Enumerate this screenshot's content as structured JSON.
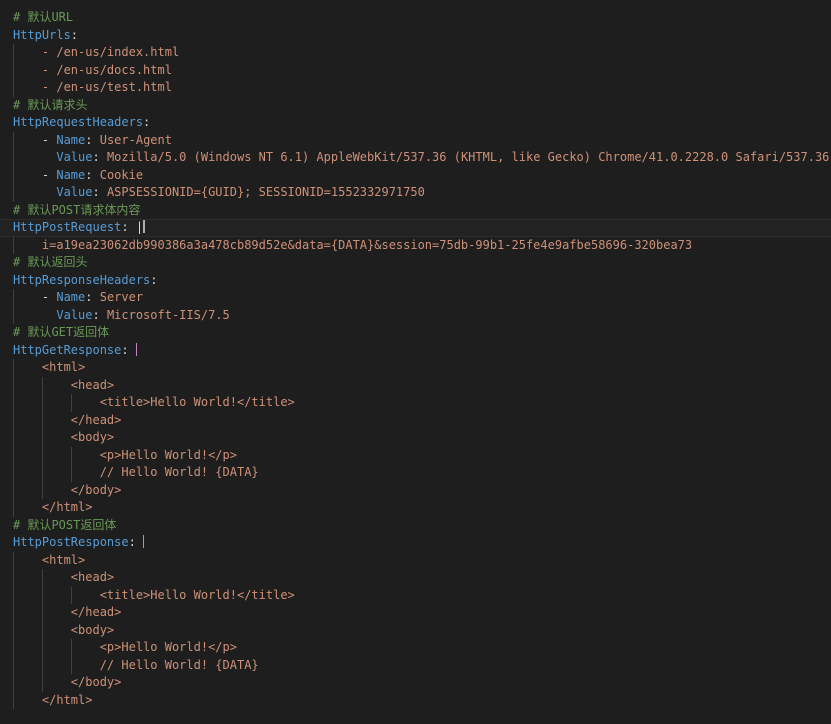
{
  "editor": {
    "lines": [
      {
        "indent": 0,
        "tokens": [
          {
            "t": "# 默认URL",
            "c": "comment"
          }
        ]
      },
      {
        "indent": 0,
        "tokens": [
          {
            "t": "HttpUrls",
            "c": "key"
          },
          {
            "t": ":",
            "c": "punct"
          }
        ]
      },
      {
        "indent": 1,
        "tokens": [
          {
            "t": "- /en-us/index.html",
            "c": "str"
          }
        ]
      },
      {
        "indent": 1,
        "tokens": [
          {
            "t": "- /en-us/docs.html",
            "c": "str"
          }
        ]
      },
      {
        "indent": 1,
        "tokens": [
          {
            "t": "- /en-us/test.html",
            "c": "str"
          }
        ]
      },
      {
        "indent": 0,
        "tokens": [
          {
            "t": "# 默认请求头",
            "c": "comment"
          }
        ]
      },
      {
        "indent": 0,
        "tokens": [
          {
            "t": "HttpRequestHeaders",
            "c": "key"
          },
          {
            "t": ":",
            "c": "punct"
          }
        ]
      },
      {
        "indent": 1,
        "tokens": [
          {
            "t": "- ",
            "c": "punct"
          },
          {
            "t": "Name",
            "c": "key"
          },
          {
            "t": ": ",
            "c": "punct"
          },
          {
            "t": "User-Agent",
            "c": "str"
          }
        ]
      },
      {
        "indent": 1,
        "extra": 2,
        "tokens": [
          {
            "t": "Value",
            "c": "key"
          },
          {
            "t": ": ",
            "c": "punct"
          },
          {
            "t": "Mozilla/5.0 (Windows NT 6.1) AppleWebKit/537.36 (KHTML, like Gecko) Chrome/41.0.2228.0 Safari/537.36",
            "c": "str"
          }
        ]
      },
      {
        "indent": 1,
        "tokens": [
          {
            "t": "- ",
            "c": "punct"
          },
          {
            "t": "Name",
            "c": "key"
          },
          {
            "t": ": ",
            "c": "punct"
          },
          {
            "t": "Cookie",
            "c": "str"
          }
        ]
      },
      {
        "indent": 1,
        "extra": 2,
        "tokens": [
          {
            "t": "Value",
            "c": "key"
          },
          {
            "t": ": ",
            "c": "punct"
          },
          {
            "t": "ASPSESSIONID={GUID}; SESSIONID=1552332971750",
            "c": "str"
          }
        ]
      },
      {
        "indent": 0,
        "tokens": [
          {
            "t": "# 默认POST请求体内容",
            "c": "comment"
          }
        ]
      },
      {
        "indent": 0,
        "current": true,
        "tokens": [
          {
            "t": "HttpPostRequest",
            "c": "key"
          },
          {
            "t": ": ",
            "c": "punct"
          },
          {
            "t": "|",
            "c": "punct"
          }
        ],
        "caret": "active"
      },
      {
        "indent": 1,
        "tokens": [
          {
            "t": "i=a19ea23062db990386a3a478cb89d52e&data={DATA}&session=75db-99b1-25fe4e9afbe58696-320bea73",
            "c": "str"
          }
        ]
      },
      {
        "indent": 0,
        "tokens": [
          {
            "t": "# 默认返回头",
            "c": "comment"
          }
        ]
      },
      {
        "indent": 0,
        "tokens": [
          {
            "t": "HttpResponseHeaders",
            "c": "key"
          },
          {
            "t": ":",
            "c": "punct"
          }
        ]
      },
      {
        "indent": 1,
        "tokens": [
          {
            "t": "- ",
            "c": "punct"
          },
          {
            "t": "Name",
            "c": "key"
          },
          {
            "t": ": ",
            "c": "punct"
          },
          {
            "t": "Server",
            "c": "str"
          }
        ]
      },
      {
        "indent": 1,
        "extra": 2,
        "tokens": [
          {
            "t": "Value",
            "c": "key"
          },
          {
            "t": ": ",
            "c": "punct"
          },
          {
            "t": "Microsoft-IIS/7.5",
            "c": "str"
          }
        ]
      },
      {
        "indent": 0,
        "tokens": [
          {
            "t": "# 默认GET返回体",
            "c": "comment"
          }
        ]
      },
      {
        "indent": 0,
        "tokens": [
          {
            "t": "HttpGetResponse",
            "c": "key"
          },
          {
            "t": ": ",
            "c": "punct"
          }
        ],
        "caret": "pipe"
      },
      {
        "indent": 1,
        "tokens": [
          {
            "t": "<html>",
            "c": "str"
          }
        ]
      },
      {
        "indent": 2,
        "tokens": [
          {
            "t": "<head>",
            "c": "str"
          }
        ]
      },
      {
        "indent": 3,
        "tokens": [
          {
            "t": "<title>Hello World!</title>",
            "c": "str"
          }
        ]
      },
      {
        "indent": 2,
        "tokens": [
          {
            "t": "</head>",
            "c": "str"
          }
        ]
      },
      {
        "indent": 2,
        "tokens": [
          {
            "t": "<body>",
            "c": "str"
          }
        ]
      },
      {
        "indent": 3,
        "tokens": [
          {
            "t": "<p>Hello World!</p>",
            "c": "str"
          }
        ]
      },
      {
        "indent": 3,
        "tokens": [
          {
            "t": "// Hello World! {DATA}",
            "c": "str"
          }
        ]
      },
      {
        "indent": 2,
        "tokens": [
          {
            "t": "</body>",
            "c": "str"
          }
        ]
      },
      {
        "indent": 1,
        "tokens": [
          {
            "t": "</html>",
            "c": "str"
          }
        ]
      },
      {
        "indent": 0,
        "tokens": [
          {
            "t": "# 默认POST返回体",
            "c": "comment"
          }
        ]
      },
      {
        "indent": 0,
        "tokens": [
          {
            "t": "HttpPostResponse",
            "c": "key"
          },
          {
            "t": ": ",
            "c": "punct"
          }
        ],
        "caret": "pipe"
      },
      {
        "indent": 1,
        "tokens": [
          {
            "t": "<html>",
            "c": "str"
          }
        ]
      },
      {
        "indent": 2,
        "tokens": [
          {
            "t": "<head>",
            "c": "str"
          }
        ]
      },
      {
        "indent": 3,
        "tokens": [
          {
            "t": "<title>Hello World!</title>",
            "c": "str"
          }
        ]
      },
      {
        "indent": 2,
        "tokens": [
          {
            "t": "</head>",
            "c": "str"
          }
        ]
      },
      {
        "indent": 2,
        "tokens": [
          {
            "t": "<body>",
            "c": "str"
          }
        ]
      },
      {
        "indent": 3,
        "tokens": [
          {
            "t": "<p>Hello World!</p>",
            "c": "str"
          }
        ]
      },
      {
        "indent": 3,
        "tokens": [
          {
            "t": "// Hello World! {DATA}",
            "c": "str"
          }
        ]
      },
      {
        "indent": 2,
        "tokens": [
          {
            "t": "</body>",
            "c": "str"
          }
        ]
      },
      {
        "indent": 1,
        "tokens": [
          {
            "t": "</html>",
            "c": "str"
          }
        ]
      }
    ]
  },
  "colors": {
    "background": "#1e1e1e",
    "comment": "#6a9955",
    "key": "#569cd6",
    "string": "#ce9178",
    "punctuation": "#d4d4d4",
    "pipe_caret": "#c586c0",
    "indent_guide": "#404040"
  }
}
